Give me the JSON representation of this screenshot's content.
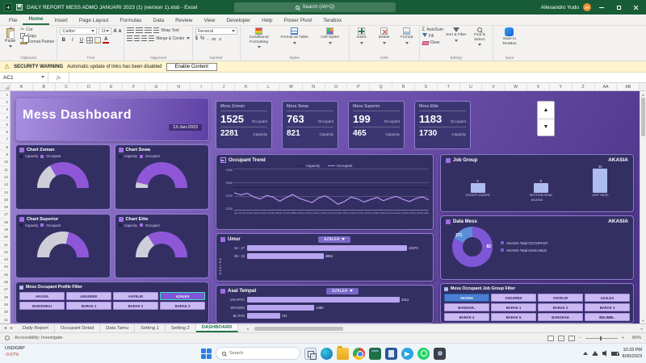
{
  "titlebar": {
    "title": "DAILY REPORT MESS ADMO JANUARI 2023 (1) (version 1).xlsb - Excel",
    "search_placeholder": "Search (Alt+Q)",
    "user_name": "Allesandro Yudo",
    "avatar_initials": "AY"
  },
  "ribbon_tabs": [
    {
      "label": "File",
      "active": false
    },
    {
      "label": "Home",
      "active": true
    },
    {
      "label": "Insert",
      "active": false
    },
    {
      "label": "Page Layout",
      "active": false
    },
    {
      "label": "Formulas",
      "active": false
    },
    {
      "label": "Data",
      "active": false
    },
    {
      "label": "Review",
      "active": false
    },
    {
      "label": "View",
      "active": false
    },
    {
      "label": "Developer",
      "active": false
    },
    {
      "label": "Help",
      "active": false
    },
    {
      "label": "Power Pivot",
      "active": false
    },
    {
      "label": "Terabox",
      "active": false
    }
  ],
  "ribbon": {
    "share": "Share",
    "clipboard": {
      "label": "Clipboard",
      "paste": "Paste",
      "cut": "Cut",
      "copy": "Copy",
      "format_painter": "Format Painter"
    },
    "font": {
      "label": "Font",
      "family": "Calibri",
      "size": "11",
      "bold": "B",
      "italic": "I",
      "underline": "U",
      "grow": "A",
      "shrink": "A"
    },
    "alignment": {
      "label": "Alignment",
      "wrap_text": "Wrap Text",
      "merge_center": "Merge & Center"
    },
    "number": {
      "label": "Number",
      "format": "General",
      "currency": "$",
      "percent": "%",
      "comma": ",",
      "increase_decimal": ".00",
      "decrease_decimal": ".0"
    },
    "styles": {
      "label": "Styles",
      "conditional": "Conditional Formatting",
      "format_table": "Format as Table",
      "cell_styles": "Cell Styles"
    },
    "cells": {
      "label": "Cells",
      "insert": "Insert",
      "delete": "Delete",
      "format": "Format"
    },
    "editing": {
      "label": "Editing",
      "autosum": "AutoSum",
      "fill": "Fill",
      "clear": "Clear",
      "sort_filter": "Sort & Filter",
      "find_select": "Find & Select"
    },
    "save": {
      "label": "Save",
      "button": "Save to TeraBox"
    }
  },
  "security": {
    "label": "SECURITY WARNING",
    "message": "Automatic update of links has been disabled",
    "button": "Enable Content"
  },
  "formula_bar": {
    "name_box": "AC1"
  },
  "grid": {
    "columns": [
      "A",
      "B",
      "C",
      "D",
      "E",
      "F",
      "G",
      "H",
      "I",
      "J",
      "K",
      "L",
      "M",
      "N",
      "O",
      "P",
      "Q",
      "R",
      "S",
      "T",
      "U",
      "V",
      "W",
      "X",
      "Y",
      "Z",
      "AA",
      "AB"
    ],
    "rows": [
      "1",
      "2",
      "3",
      "4",
      "5",
      "6",
      "7",
      "8",
      "9",
      "10",
      "11",
      "12",
      "13",
      "14",
      "15",
      "16",
      "17",
      "18",
      "19",
      "20",
      "21",
      "22",
      "23",
      "24",
      "25",
      "26",
      "27",
      "28",
      "29",
      "30",
      "31"
    ]
  },
  "dashboard": {
    "title": "Mess Dashboard",
    "date": "13-Jan-2023",
    "kpis": [
      {
        "name": "Mess Zoman",
        "occupant": "1525",
        "occupant_label": "Occupant",
        "capacity": "2281",
        "capacity_label": "Capacity"
      },
      {
        "name": "Mess Sewa",
        "occupant": "763",
        "occupant_label": "Occupant",
        "capacity": "821",
        "capacity_label": "Capacity"
      },
      {
        "name": "Mess Superior",
        "occupant": "199",
        "occupant_label": "Occupant",
        "capacity": "465",
        "capacity_label": "Capacity"
      },
      {
        "name": "Mess Elite",
        "occupant": "1183",
        "occupant_label": "Occupant",
        "capacity": "1730",
        "capacity_label": "Capacity"
      }
    ],
    "gauges": [
      {
        "title": "Chart Zoman",
        "capacity_label": "Capacity",
        "occupant_label": "Occupant",
        "pct": 67
      },
      {
        "title": "Chart Sewa",
        "capacity_label": "Capacity",
        "occupant_label": "Occupant",
        "pct": 93
      },
      {
        "title": "Chart Superior",
        "capacity_label": "Capacity",
        "occupant_label": "Occupant",
        "pct": 43
      },
      {
        "title": "Chart Elite",
        "capacity_label": "Capacity",
        "occupant_label": "Occupant",
        "pct": 68
      }
    ],
    "trend": {
      "title": "Occupant Trend",
      "capacity_label": "Capacity",
      "occupant_label": "Occupant",
      "y_ticks": [
        "2350",
        "2300",
        "2250",
        "2200"
      ],
      "ylim": [
        2200,
        2350
      ],
      "capacity_value": 2281,
      "occupant": [
        2262,
        2254,
        2260,
        2247,
        2239,
        2252,
        2246,
        2231,
        2244,
        2256,
        2242,
        2234,
        2226,
        2243,
        2251,
        2237,
        2220,
        2230,
        2246,
        2240,
        2228,
        2237,
        2245,
        2233,
        2242,
        2249,
        2238,
        2230,
        2241,
        2247,
        2236
      ],
      "x_labels": [
        "Jan-01",
        "Jan-02",
        "Jan-03",
        "Jan-04",
        "Jan-05",
        "Jan-06",
        "Jan-07",
        "Jan-08",
        "Jan-09",
        "Jan-10",
        "Jan-11",
        "Jan-12",
        "Jan-13",
        "Jan-14",
        "Jan-15",
        "Jan-16",
        "Jan-17",
        "Jan-18",
        "Jan-19",
        "Jan-20",
        "Jan-21",
        "Jan-22",
        "Jan-23",
        "Jan-24",
        "Jan-25",
        "Jan-26",
        "Jan-27",
        "Jan-28",
        "Jan-29",
        "Jan-30",
        "Jan-31"
      ]
    },
    "job_group": {
      "title": "Job Group",
      "filter_value": "AKASIA",
      "footer": "AKASIA",
      "items": [
        {
          "label": "GROUP LEADER",
          "value": "9",
          "h": 12
        },
        {
          "label": "SECTION HEAD",
          "value": "9",
          "h": 12
        },
        {
          "label": "UNIT HEAD",
          "value": "24",
          "h": 30
        }
      ]
    },
    "data_mess": {
      "title": "Data Mess",
      "filter_value": "AKASIA",
      "occupant_value": "371",
      "available_value": "82",
      "occupant_pct": 82,
      "legend": [
        {
          "label": "AKASIA Total OCCUPANT"
        },
        {
          "label": "AKASIA Total AVAILABLE"
        }
      ]
    },
    "umur": {
      "title": "Umur",
      "filter_value": "AZALEA",
      "axis_label": "AZALEA",
      "bars": [
        {
          "label": "22 - 27",
          "value": "10370",
          "pct": 88
        },
        {
          "label": "28 - 33",
          "value": "4866",
          "pct": 42
        }
      ]
    },
    "asal_tempat": {
      "title": "Asal Tempat",
      "filter_value": "AZALEA",
      "bars": [
        {
          "label": "JAKARTA",
          "value": "3412",
          "pct": 84
        },
        {
          "label": "SRAGEN",
          "value": "1480",
          "pct": 37
        },
        {
          "label": "BLITAR",
          "value": "724",
          "pct": 18
        }
      ]
    },
    "profile_filter": {
      "title": "Mess Occupant Profile Filter",
      "items": [
        {
          "label": "AKASIA",
          "selected": false
        },
        {
          "label": "ANGGREK",
          "selected": false
        },
        {
          "label": "ANYELIR",
          "selected": false
        },
        {
          "label": "AZALEA",
          "selected": true
        },
        {
          "label": "BANGKIRAI",
          "selected": false
        },
        {
          "label": "BARAK 1",
          "selected": false
        },
        {
          "label": "BARAK 2",
          "selected": false
        },
        {
          "label": "BARAK 3",
          "selected": false
        }
      ]
    },
    "job_group_filter": {
      "title": "Mess Occupant Job Group Filter",
      "items": [
        {
          "label": "AKASIA",
          "selected": true
        },
        {
          "label": "ANGGREK",
          "selected": false
        },
        {
          "label": "ANYELIR",
          "selected": false
        },
        {
          "label": "AZALEA",
          "selected": false
        },
        {
          "label": "BANGKIR..",
          "selected": false
        },
        {
          "label": "BARAK 1",
          "selected": false
        },
        {
          "label": "BARAK 2",
          "selected": false
        },
        {
          "label": "BARAK 3",
          "selected": false
        },
        {
          "label": "BARAK 4",
          "selected": false
        },
        {
          "label": "BARAK 5",
          "selected": false
        },
        {
          "label": "BAROKAH",
          "selected": false
        },
        {
          "label": "BELIMBI..",
          "selected": false
        }
      ]
    }
  },
  "sheet_tabs": [
    {
      "label": "Daily Report",
      "active": false
    },
    {
      "label": "Occupant Detail",
      "active": false
    },
    {
      "label": "Data Tamu",
      "active": false
    },
    {
      "label": "Setting 1",
      "active": false
    },
    {
      "label": "Setting 2",
      "active": false
    },
    {
      "label": "DASHBOARD",
      "active": true
    }
  ],
  "status_bar": {
    "accessibility": "Accessibility: Investigate",
    "zoom_out": "−",
    "zoom_in": "+",
    "zoom": "80%"
  },
  "taskbar": {
    "widget_primary": "USD/GBP",
    "widget_secondary": "-0.67%",
    "search_placeholder": "Search",
    "time": "10:33 PM",
    "date": "8/30/2023"
  },
  "icons": {
    "warning": "⚠",
    "fx": "fx",
    "sigma": "Σ",
    "scissors": "✂",
    "spinner_up": "▲",
    "spinner_down": "▼",
    "nav_left": "◄",
    "nav_right": "►",
    "arrow_up_small": "▲",
    "arrow_down_small": "▼"
  },
  "colors": {
    "titlebar_green": "#185c37",
    "ribbon_active_green": "#217346",
    "dashboard_purple": "#7e57d6",
    "selected_blue": "#4a7fd4",
    "warning_bg": "#fff4ce",
    "negative_red": "#c0392b"
  }
}
